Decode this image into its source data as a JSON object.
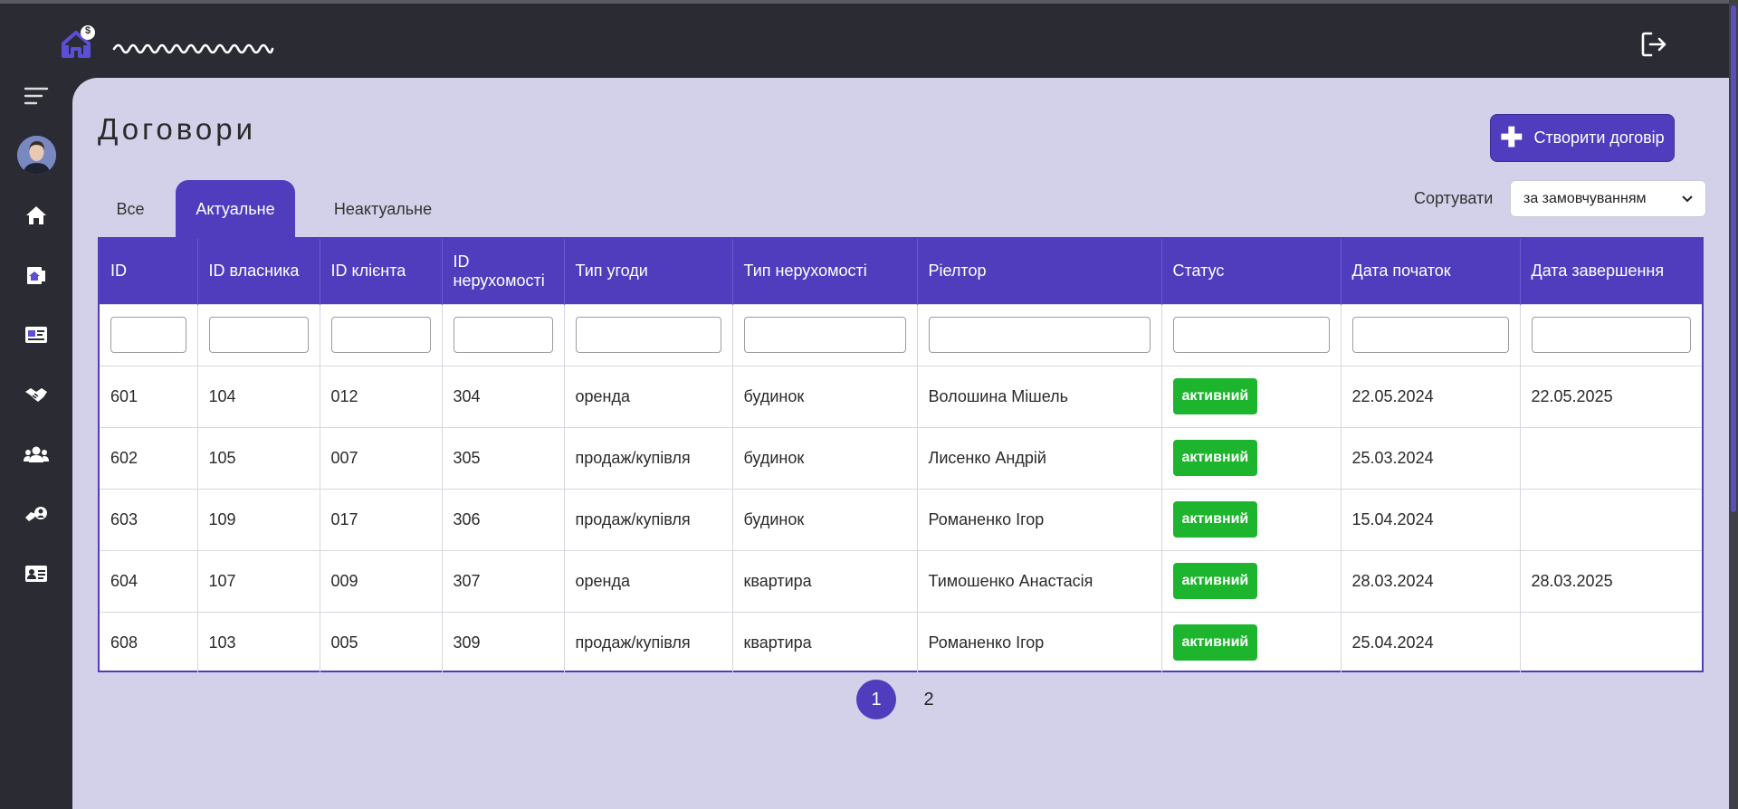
{
  "app": {
    "logo_badge": "$",
    "logout_icon": "logout-icon"
  },
  "sidebar": {
    "items": [
      {
        "name": "menu",
        "icon": "hamburger-menu-icon"
      },
      {
        "name": "home",
        "icon": "house-icon"
      },
      {
        "name": "properties",
        "icon": "property-document-icon"
      },
      {
        "name": "listings",
        "icon": "card-icon"
      },
      {
        "name": "contracts",
        "icon": "handshake-icon"
      },
      {
        "name": "clients",
        "icon": "users-icon"
      },
      {
        "name": "realtors",
        "icon": "hand-user-icon"
      },
      {
        "name": "profile",
        "icon": "id-card-icon"
      }
    ]
  },
  "page": {
    "title": "Договори",
    "create_button": "Створити договір"
  },
  "tabs": [
    {
      "label": "Все",
      "active": false
    },
    {
      "label": "Актуальне",
      "active": true
    },
    {
      "label": "Неактуальне",
      "active": false
    }
  ],
  "sort": {
    "label": "Сортувати",
    "selected": "за замовчуванням"
  },
  "table": {
    "columns": [
      "ID",
      "ID власника",
      "ID клієнта",
      "ID нерухомості",
      "Тип угоди",
      "Тип нерухомості",
      "Ріелтор",
      "Статус",
      "Дата початок",
      "Дата завершення"
    ],
    "rows": [
      {
        "id": "601",
        "owner": "104",
        "client": "012",
        "property": "304",
        "deal": "оренда",
        "ptype": "будинок",
        "realtor": "Волошина Мішель",
        "status": "активний",
        "start": "22.05.2024",
        "end": "22.05.2025"
      },
      {
        "id": "602",
        "owner": "105",
        "client": "007",
        "property": "305",
        "deal": "продаж/купівля",
        "ptype": "будинок",
        "realtor": "Лисенко Андрій",
        "status": "активний",
        "start": "25.03.2024",
        "end": ""
      },
      {
        "id": "603",
        "owner": "109",
        "client": "017",
        "property": "306",
        "deal": "продаж/купівля",
        "ptype": "будинок",
        "realtor": "Романенко Ігор",
        "status": "активний",
        "start": "15.04.2024",
        "end": ""
      },
      {
        "id": "604",
        "owner": "107",
        "client": "009",
        "property": "307",
        "deal": "оренда",
        "ptype": "квартира",
        "realtor": "Тимошенко Анастасія",
        "status": "активний",
        "start": "28.03.2024",
        "end": "28.03.2025"
      },
      {
        "id": "608",
        "owner": "103",
        "client": "005",
        "property": "309",
        "deal": "продаж/купівля",
        "ptype": "квартира",
        "realtor": "Романенко Ігор",
        "status": "активний",
        "start": "25.04.2024",
        "end": ""
      }
    ]
  },
  "pagination": {
    "pages": [
      "1",
      "2"
    ],
    "current": "1"
  },
  "colors": {
    "accent": "#4f3dbd",
    "status_active": "#1db52d",
    "content_bg": "#d2d1e9",
    "chrome_bg": "#2b2b33"
  }
}
